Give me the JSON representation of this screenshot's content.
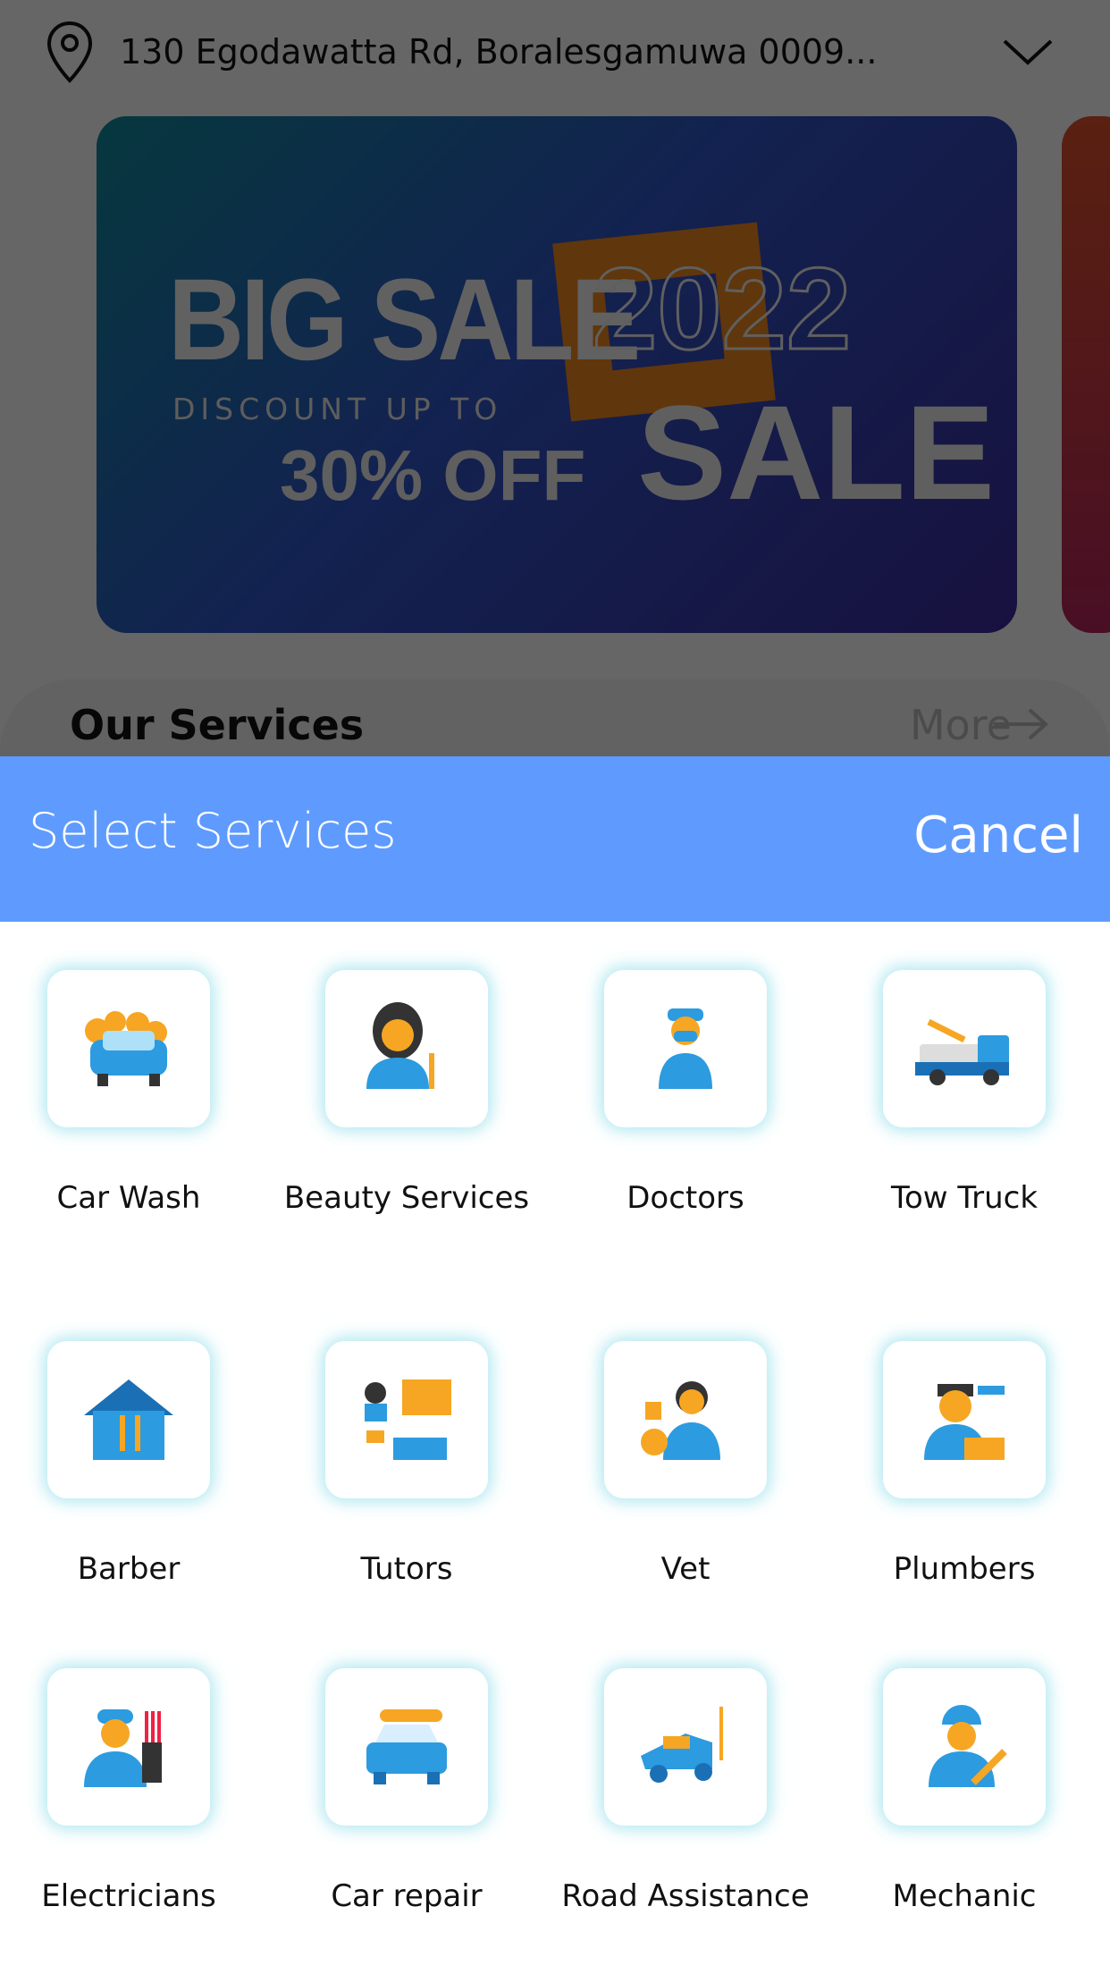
{
  "header": {
    "address": "130 Egodawatta Rd, Boralesgamuwa 0009...",
    "location_icon": "map-pin-icon",
    "dropdown_icon": "chevron-down-icon"
  },
  "banner": {
    "line1": "BIG SALE",
    "line2": "DISCOUNT UP TO",
    "line3": "30% OFF",
    "year": "2022",
    "sale": "SALE"
  },
  "services_section": {
    "title": "Our Services",
    "more": "More"
  },
  "sheet": {
    "title": "Select Services",
    "cancel": "Cancel",
    "items": [
      {
        "label": "Car Wash",
        "icon": "car-wash-icon"
      },
      {
        "label": "Beauty Services",
        "icon": "beauty-icon"
      },
      {
        "label": "Doctors",
        "icon": "doctor-icon"
      },
      {
        "label": "Tow Truck",
        "icon": "tow-truck-icon"
      },
      {
        "label": "Barber",
        "icon": "barber-icon"
      },
      {
        "label": "Tutors",
        "icon": "tutor-icon"
      },
      {
        "label": "Vet",
        "icon": "vet-icon"
      },
      {
        "label": "Plumbers",
        "icon": "plumber-icon"
      },
      {
        "label": "Electricians",
        "icon": "electrician-icon"
      },
      {
        "label": "Car repair",
        "icon": "car-repair-icon"
      },
      {
        "label": "Road Assistance",
        "icon": "road-assistance-icon"
      },
      {
        "label": "Mechanic",
        "icon": "mechanic-icon"
      }
    ]
  },
  "colors": {
    "sheet_header": "#5f9bff",
    "icon_blue": "#2c9be0",
    "icon_orange": "#f6a623"
  }
}
